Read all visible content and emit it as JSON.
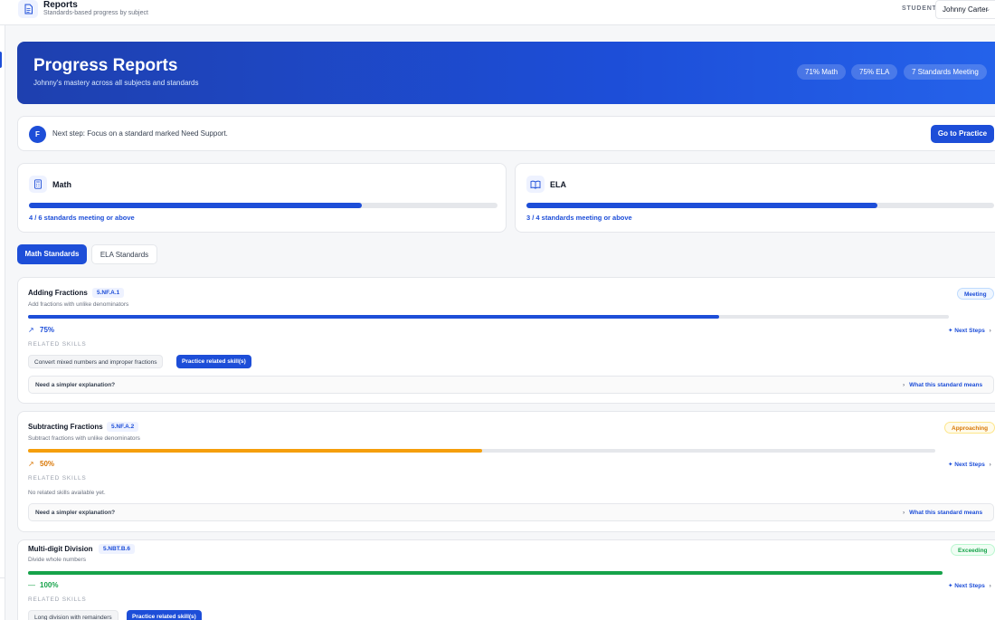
{
  "header": {
    "title": "Reports",
    "subtitle": "Standards-based progress by subject",
    "student_label": "STUDENT",
    "student_name": "Johnny Carter"
  },
  "hero": {
    "title": "Progress Reports",
    "subtitle": "Johnny's mastery across all subjects and standards",
    "pills": [
      "71% Math",
      "75% ELA",
      "7 Standards Meeting"
    ]
  },
  "next_step": {
    "avatar_letter": "F",
    "message": "Next step: Focus on a standard marked Need Support.",
    "button": "Go to Practice"
  },
  "subjects": [
    {
      "name": "Math",
      "meta": "4 / 6 standards meeting or above",
      "progress": 0.71
    },
    {
      "name": "ELA",
      "meta": "3 / 4 standards meeting or above",
      "progress": 0.75
    }
  ],
  "tabs": [
    "Math Standards",
    "ELA Standards"
  ],
  "common": {
    "related_skills": "RELATED SKILLS",
    "next_steps": "✦ Next Steps",
    "need_simpler": "Need a simpler explanation?",
    "what_means": "What this standard means",
    "no_skills": "No related skills available yet."
  },
  "standards": [
    {
      "title": "Adding Fractions",
      "code": "5.NF.A.1",
      "description": "Add fractions with unlike denominators",
      "status": "Meeting",
      "percent": "75%",
      "progress": 0.75,
      "skills": [
        "Convert mixed numbers and improper fractions"
      ],
      "practice": "Practice related skill(s)"
    },
    {
      "title": "Subtracting Fractions",
      "code": "5.NF.A.2",
      "description": "Subtract fractions with unlike denominators",
      "status": "Approaching",
      "percent": "50%",
      "progress": 0.5
    },
    {
      "title": "Multi-digit Division",
      "code": "5.NBT.B.6",
      "description": "Divide whole numbers",
      "status": "Exceeding",
      "percent": "100%",
      "progress": 1.0,
      "skills": [
        "Long division with remainders"
      ],
      "practice": "Practice related skill(s)"
    }
  ],
  "colors": {
    "primary": "#1d4ed8",
    "meeting": "#1d4ed8",
    "approaching": "#f59e0b",
    "exceeding": "#16a34a"
  },
  "icons": {
    "app": "report-document-icon",
    "math": "calculator-icon",
    "ela": "open-book-icon",
    "trend": "trend-up-icon",
    "flat": "trend-flat-icon"
  }
}
